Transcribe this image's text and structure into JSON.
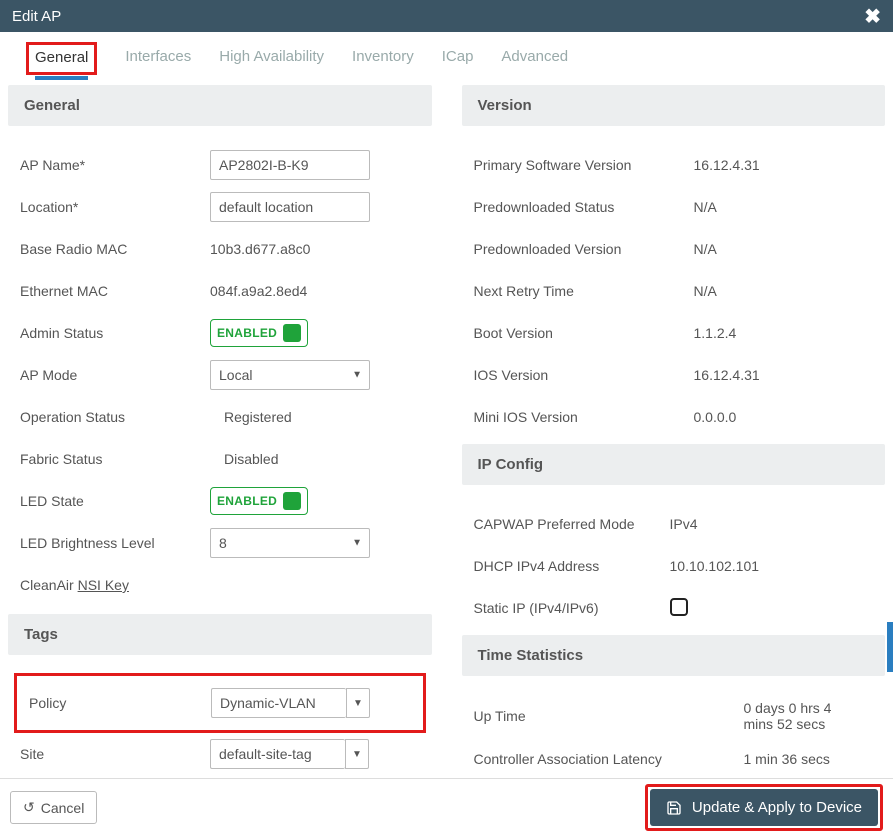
{
  "dialog": {
    "title": "Edit AP"
  },
  "tabs": [
    "General",
    "Interfaces",
    "High Availability",
    "Inventory",
    "ICap",
    "Advanced"
  ],
  "sections": {
    "general": "General",
    "tags": "Tags",
    "version": "Version",
    "ipconfig": "IP Config",
    "timestats": "Time Statistics"
  },
  "general": {
    "ap_name_label": "AP Name*",
    "ap_name_value": "AP2802I-B-K9",
    "location_label": "Location*",
    "location_value": "default location",
    "base_mac_label": "Base Radio MAC",
    "base_mac_value": "10b3.d677.a8c0",
    "eth_mac_label": "Ethernet MAC",
    "eth_mac_value": "084f.a9a2.8ed4",
    "admin_status_label": "Admin Status",
    "admin_status_value": "ENABLED",
    "ap_mode_label": "AP Mode",
    "ap_mode_value": "Local",
    "op_status_label": "Operation Status",
    "op_status_value": "Registered",
    "fabric_label": "Fabric Status",
    "fabric_value": "Disabled",
    "led_state_label": "LED State",
    "led_state_value": "ENABLED",
    "led_bright_label": "LED Brightness Level",
    "led_bright_value": "8",
    "cleanair_label": "CleanAir ",
    "cleanair_link": "NSI Key"
  },
  "tags": {
    "policy_label": "Policy",
    "policy_value": "Dynamic-VLAN",
    "site_label": "Site",
    "site_value": "default-site-tag"
  },
  "version": {
    "primary_label": "Primary Software Version",
    "primary_value": "16.12.4.31",
    "predl_status_label": "Predownloaded Status",
    "predl_status_value": "N/A",
    "predl_ver_label": "Predownloaded Version",
    "predl_ver_value": "N/A",
    "retry_label": "Next Retry Time",
    "retry_value": "N/A",
    "boot_label": "Boot Version",
    "boot_value": "1.1.2.4",
    "ios_label": "IOS Version",
    "ios_value": "16.12.4.31",
    "mini_label": "Mini IOS Version",
    "mini_value": "0.0.0.0"
  },
  "ipconfig": {
    "capwap_label": "CAPWAP Preferred Mode",
    "capwap_value": "IPv4",
    "dhcp_label": "DHCP IPv4 Address",
    "dhcp_value": "10.10.102.101",
    "static_label": "Static IP (IPv4/IPv6)"
  },
  "timestats": {
    "uptime_label": "Up Time",
    "uptime_value": "0 days 0 hrs 4 mins 52 secs",
    "latency_label": "Controller Association Latency",
    "latency_value": "1 min 36 secs"
  },
  "footer": {
    "cancel": "Cancel",
    "apply": "Update & Apply to Device"
  }
}
